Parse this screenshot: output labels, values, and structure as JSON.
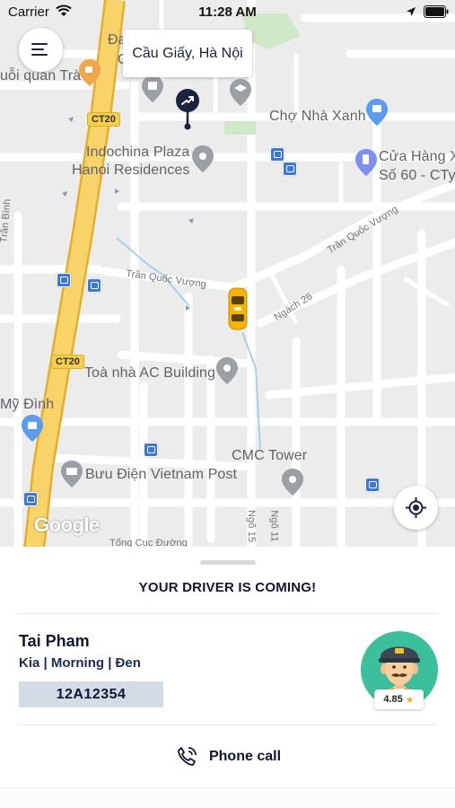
{
  "status_bar": {
    "carrier": "Carrier",
    "time": "11:28 AM"
  },
  "map": {
    "location_callout": "Cầu Giấy,  Hà Nội",
    "labels": {
      "da": "Đa",
      "ga": "G",
      "quan_tra": "uỗi quán Trà",
      "cho_nha_xanh": "Chợ Nhà Xanh",
      "indochina_1": "Indochina Plaza",
      "indochina_2": "Hanoi Residences",
      "cua_hang_1": "Cửa Hàng X",
      "cua_hang_2": "Số 60 - CTy",
      "tran_binh": "Trần Bình",
      "tran_quoc_vuong_1": "Trần Quốc Vượng",
      "tran_quoc_vuong_2": "Trần Quốc Vượng",
      "ngach_26": "Ngách 26",
      "ac_building": "Toà nhà AC Building",
      "my_dinh": "Mỹ Đình",
      "cmc_tower": "CMC Tower",
      "buu_dien": "Bưu Điện Vietnam Post",
      "ngo_15": "Ngõ 15",
      "ngo_11": "Ngõ 11",
      "tong_cuc": "Tổng Cục Đường",
      "google": "Google"
    },
    "road_badges": [
      "CT20",
      "CT20"
    ]
  },
  "sheet": {
    "title": "YOUR DRIVER IS COMING!",
    "driver": {
      "name": "Tai Pham",
      "vehicle": "Kia | Morning | Đen",
      "plate": "12A12354",
      "rating": "4.85"
    },
    "phone_call_label": "Phone call"
  },
  "colors": {
    "accent_navy": "#111633",
    "plate_bg": "#d3dce4",
    "highway_yellow": "#f6c44a",
    "avatar_teal": "#3bbf9c",
    "taxi_yellow": "#f4b400",
    "rating_star": "#f3b321"
  },
  "icons": [
    "wifi-icon",
    "location-arrow-icon",
    "battery-icon",
    "menu-icon",
    "pickup-pin-icon",
    "taxi-icon",
    "crosshair-icon",
    "phone-icon",
    "driver-avatar-icon",
    "star-icon",
    "bus-stop-icon",
    "poi-pin-icon"
  ]
}
